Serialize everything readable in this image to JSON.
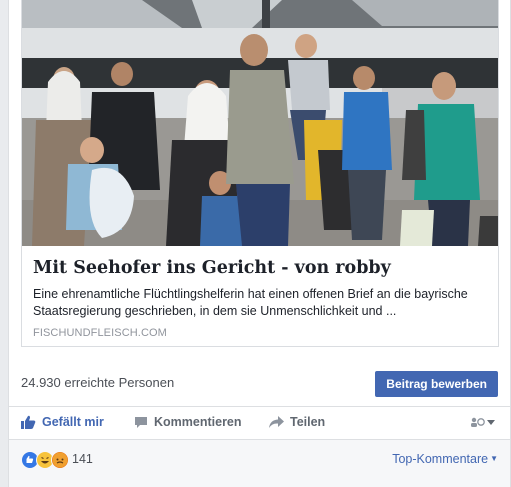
{
  "colors": {
    "brand": "#4267b2",
    "link": "#365899",
    "text": "#1d2129",
    "muted": "#90949c",
    "bg": "#e9ebee"
  },
  "link_preview": {
    "image_icon": "photo-refugees-train-station",
    "title": "Mit Seehofer ins Gericht - von robby",
    "description": "Eine ehrenamtliche Flüchtlingshelferin hat einen offenen Brief an die bayrische Staatsregierung geschrieben, in dem sie Unmenschlichkeit und ...",
    "domain": "FISCHUNDFLEISCH.COM"
  },
  "insights": {
    "reach_text": "24.930 erreichte Personen",
    "boost_label": "Beitrag bewerben"
  },
  "actions": {
    "like_label": "Gefällt mir",
    "comment_label": "Kommentieren",
    "share_label": "Teilen",
    "audience_icon": "audience-selector-icon"
  },
  "reactions": {
    "icons": [
      "like-reaction-icon",
      "haha-reaction-icon",
      "angry-reaction-icon"
    ],
    "count": "141",
    "sort_label": "Top-Kommentare"
  }
}
